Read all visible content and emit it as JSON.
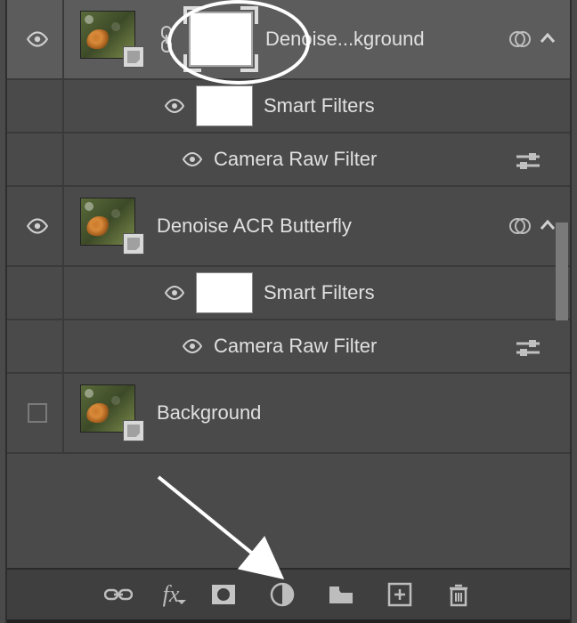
{
  "layers": [
    {
      "name": "Denoise...kground",
      "smart_filters_label": "Smart Filters",
      "filter_name": "Camera Raw Filter"
    },
    {
      "name": "Denoise ACR Butterfly",
      "smart_filters_label": "Smart Filters",
      "filter_name": "Camera Raw Filter"
    },
    {
      "name": "Background"
    }
  ],
  "bottom_bar": {
    "fx_label": "fx"
  }
}
